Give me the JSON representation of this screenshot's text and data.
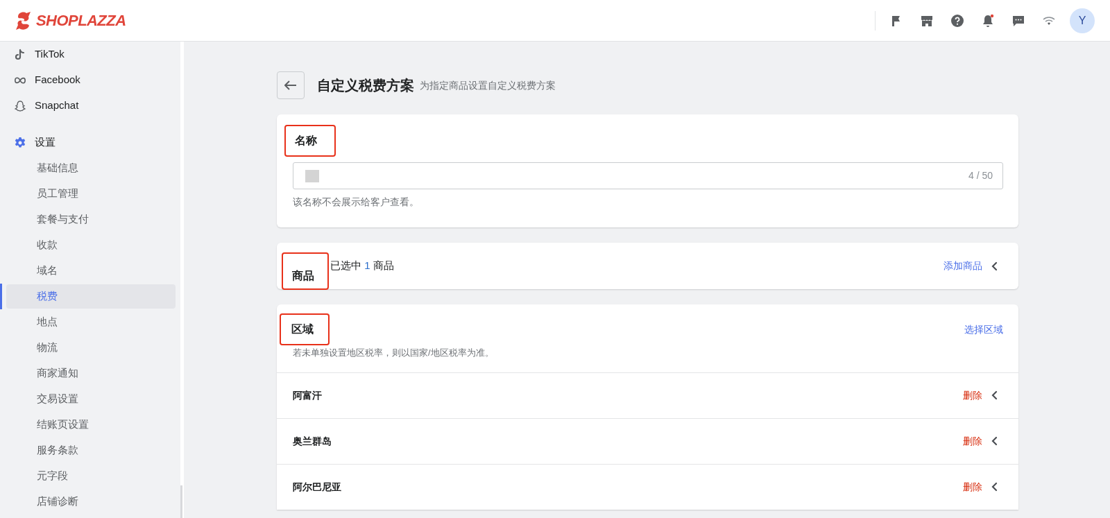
{
  "header": {
    "logo": "SHOPLAZZA",
    "avatar": "Y",
    "notification_badge": true
  },
  "sidebar": {
    "channels": [
      {
        "label": "TikTok",
        "kind": "tiktok"
      },
      {
        "label": "Facebook",
        "kind": "meta"
      },
      {
        "label": "Snapchat",
        "kind": "ghost"
      }
    ],
    "group": {
      "label": "设置",
      "children": [
        {
          "label": "基础信息",
          "selected": false
        },
        {
          "label": "员工管理",
          "selected": false
        },
        {
          "label": "套餐与支付",
          "selected": false
        },
        {
          "label": "收款",
          "selected": false
        },
        {
          "label": "域名",
          "selected": false
        },
        {
          "label": "税费",
          "selected": true
        },
        {
          "label": "地点",
          "selected": false
        },
        {
          "label": "物流",
          "selected": false
        },
        {
          "label": "商家通知",
          "selected": false
        },
        {
          "label": "交易设置",
          "selected": false
        },
        {
          "label": "结账页设置",
          "selected": false
        },
        {
          "label": "服务条款",
          "selected": false
        },
        {
          "label": "元字段",
          "selected": false
        },
        {
          "label": "店铺诊断",
          "selected": false
        }
      ]
    }
  },
  "page": {
    "title": "自定义税费方案",
    "subtitle": "为指定商品设置自定义税费方案"
  },
  "name_card": {
    "heading": "名称",
    "counter": "4 / 50",
    "help": "该名称不会展示给客户查看。"
  },
  "product_card": {
    "heading": "商品",
    "selected_prefix": "已选中",
    "selected_count": "1",
    "selected_suffix": "商品",
    "action": "添加商品"
  },
  "region_card": {
    "heading": "区域",
    "action": "选择区域",
    "help": "若未单独设置地区税率，则以国家/地区税率为准。",
    "rows": [
      {
        "name": "阿富汗",
        "action": "删除"
      },
      {
        "name": "奥兰群岛",
        "action": "删除"
      },
      {
        "name": "阿尔巴尼亚",
        "action": "删除"
      }
    ]
  }
}
